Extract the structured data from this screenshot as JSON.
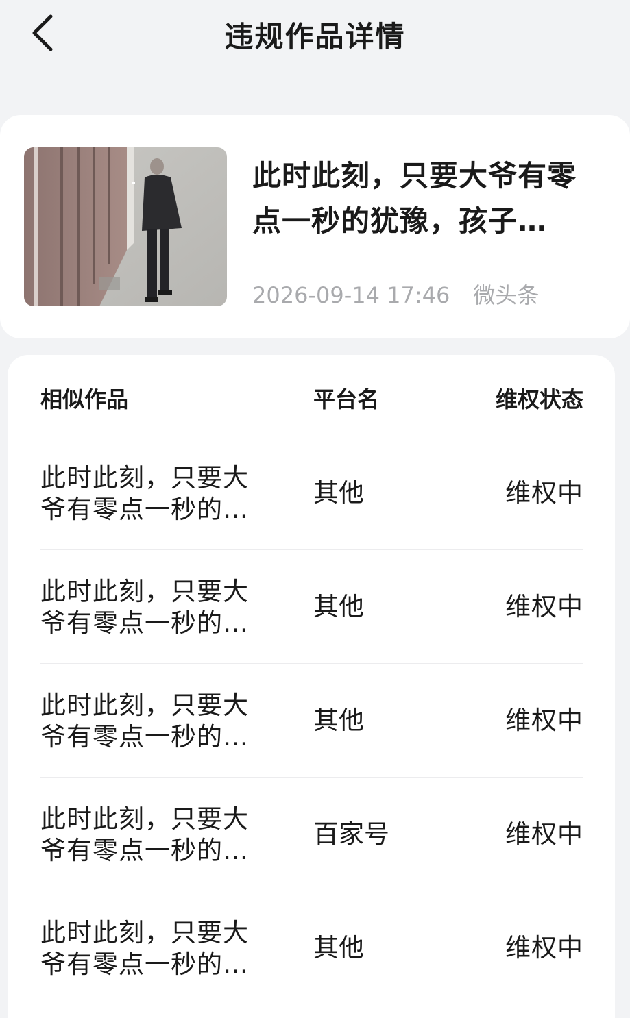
{
  "header": {
    "title": "违规作品详情",
    "back_icon": "chevron-left-icon"
  },
  "work": {
    "title": "此时此刻，只要大爷有零点一秒的犹豫，孩子…",
    "timestamp": "2026-09-14 17:46",
    "platform": "微头条"
  },
  "similar_table": {
    "columns": [
      "相似作品",
      "平台名",
      "维权状态"
    ],
    "rows": [
      {
        "title": "此时此刻，只要大爷有零点一秒的…",
        "platform": "其他",
        "status": "维权中"
      },
      {
        "title": "此时此刻，只要大爷有零点一秒的…",
        "platform": "其他",
        "status": "维权中"
      },
      {
        "title": "此时此刻，只要大爷有零点一秒的…",
        "platform": "其他",
        "status": "维权中"
      },
      {
        "title": "此时此刻，只要大爷有零点一秒的…",
        "platform": "百家号",
        "status": "维权中"
      },
      {
        "title": "此时此刻，只要大爷有零点一秒的…",
        "platform": "其他",
        "status": "维权中"
      }
    ]
  },
  "colors": {
    "background": "#f2f3f5",
    "card": "#ffffff",
    "text": "#1a1a1a",
    "meta_text": "#a9aaad",
    "divider": "#ececee"
  }
}
